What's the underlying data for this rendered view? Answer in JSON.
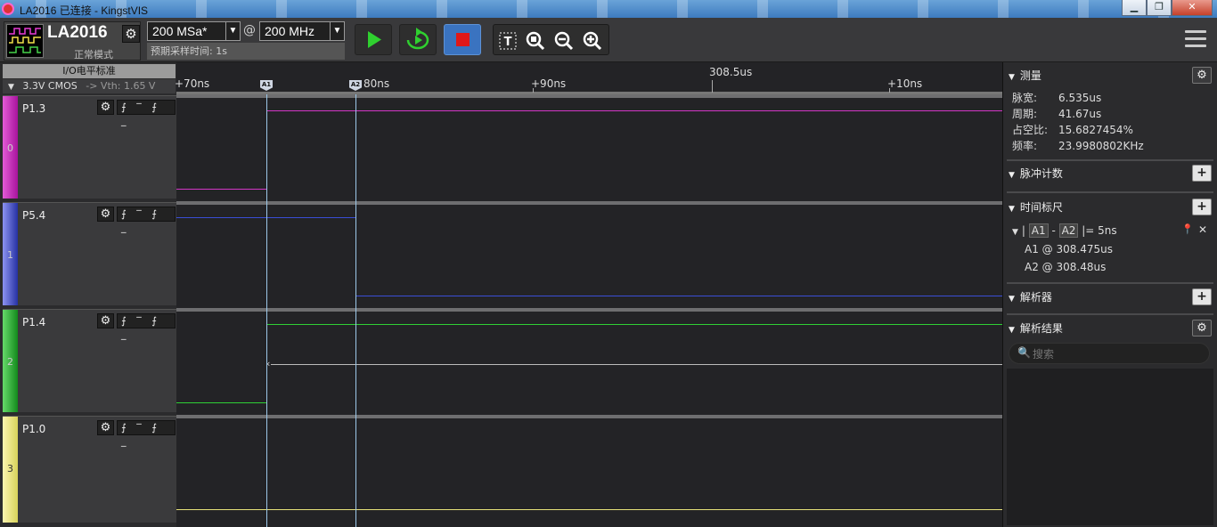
{
  "window": {
    "title": "LA2016 已连接 - KingstVIS",
    "min": "▁",
    "restore": "❐",
    "close": "✕"
  },
  "device": {
    "name": "LA2016",
    "mode": "正常模式"
  },
  "sample": {
    "rate": "200 MSa*",
    "at": "@",
    "clock": "200 MHz",
    "expected_time": "预期采样时间: 1s"
  },
  "io": {
    "header": "I/O电平标准",
    "standard": "3.3V CMOS",
    "vth": "-> Vth: 1.65 V"
  },
  "channels": [
    {
      "label": "P1.3",
      "index": "0",
      "color": "#c21fb8"
    },
    {
      "label": "P5.4",
      "index": "1",
      "color": "#2a3db0"
    },
    {
      "label": "P1.4",
      "index": "2",
      "color": "#1e9a26"
    },
    {
      "label": "P1.0",
      "index": "3",
      "color": "#e6e27a"
    }
  ],
  "trigger_glyphs": "⨍ ‾ ⨍ _",
  "ruler": {
    "labels": [
      "+70ns",
      "80ns",
      "+90ns",
      "308.5us",
      "+10ns"
    ],
    "markers": [
      "A1",
      "A2"
    ]
  },
  "panel": {
    "measure": {
      "title": "测量",
      "rows": [
        {
          "k": "脉宽:",
          "v": "6.535us"
        },
        {
          "k": "周期:",
          "v": "41.67us"
        },
        {
          "k": "占空比:",
          "v": "15.6827454%"
        },
        {
          "k": "频率:",
          "v": "23.9980802KHz"
        }
      ]
    },
    "pulse_count": {
      "title": "脉冲计数"
    },
    "time_ruler": {
      "title": "时间标尺",
      "delta_a": "A1",
      "delta_b": "A2",
      "delta_value": "= 5ns",
      "a1": "A1 @ 308.475us",
      "a2": "A2 @ 308.48us"
    },
    "decoder": {
      "title": "解析器"
    },
    "decode_results": {
      "title": "解析结果",
      "search_placeholder": "搜索"
    }
  }
}
